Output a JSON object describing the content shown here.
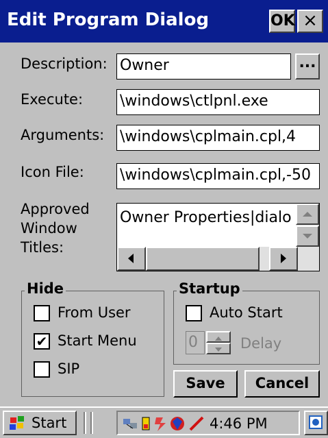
{
  "dialog": {
    "title": "Edit Program Dialog",
    "ok_label": "OK",
    "close_label": "×"
  },
  "fields": {
    "description_label": "Description:",
    "description_value": "Owner",
    "browse_label": "...",
    "execute_label": "Execute:",
    "execute_value": "\\windows\\ctlpnl.exe",
    "arguments_label": "Arguments:",
    "arguments_value": "\\windows\\cplmain.cpl,4",
    "icon_file_label": "Icon File:",
    "icon_file_value": "\\windows\\cplmain.cpl,-50",
    "approved_label_1": "Approved",
    "approved_label_2": "Window",
    "approved_label_3": "Titles:",
    "approved_item": "Owner Properties|dialo"
  },
  "hide_group": {
    "title": "Hide",
    "from_user_label": "From User",
    "from_user_checked": false,
    "start_menu_label": "Start Menu",
    "start_menu_checked": true,
    "sip_label": "SIP",
    "sip_checked": false
  },
  "startup_group": {
    "title": "Startup",
    "auto_start_label": "Auto Start",
    "auto_start_checked": false,
    "delay_value": "0",
    "delay_label": "Delay"
  },
  "buttons": {
    "save_label": "Save",
    "cancel_label": "Cancel"
  },
  "taskbar": {
    "start_label": "Start",
    "clock": "4:46 PM"
  },
  "colors": {
    "title_bar": "#0a1e8f",
    "face": "#c0c0c0"
  },
  "icons": [
    "windows-flag-icon",
    "network-icon",
    "battery-icon",
    "connection-icon",
    "pen-icon",
    "desktop-icon"
  ]
}
